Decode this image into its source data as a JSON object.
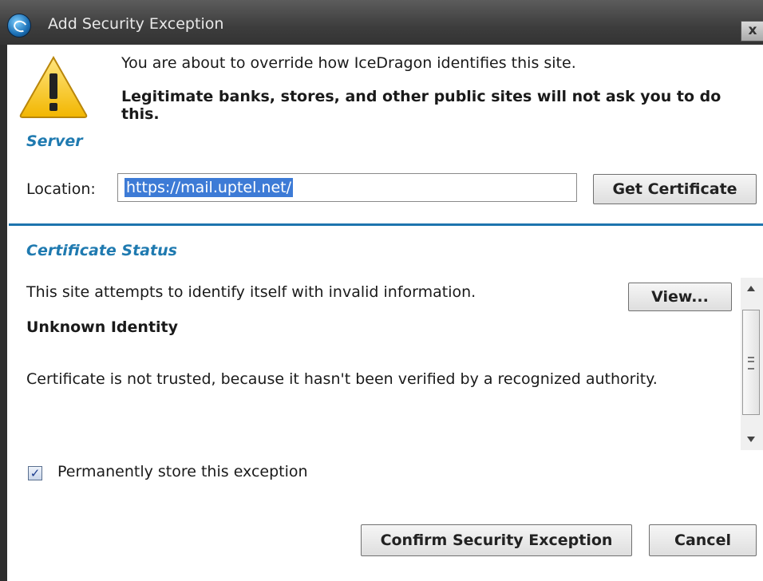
{
  "window": {
    "title": "Add Security Exception",
    "close_label": "x"
  },
  "warning": {
    "line1": "You are about to override how IceDragon identifies this site.",
    "line2": "Legitimate banks, stores, and other public sites will not ask you to do this."
  },
  "server": {
    "heading": "Server",
    "location_label": "Location:",
    "location_value": "https://mail.uptel.net/",
    "get_certificate_label": "Get Certificate"
  },
  "certificate_status": {
    "heading": "Certificate Status",
    "status_text": "This site attempts to identify itself with invalid information.",
    "view_label": "View...",
    "identity_heading": "Unknown Identity",
    "detail_text": "Certificate is not trusted, because it hasn't been verified by a recognized authority."
  },
  "permanent": {
    "label": "Permanently store this exception",
    "checked": true
  },
  "buttons": {
    "confirm_label": "Confirm Security Exception",
    "cancel_label": "Cancel"
  },
  "colors": {
    "accent": "#1f7ab0",
    "titlebar": "#3d3d3d",
    "selection": "#3d7bd6"
  }
}
